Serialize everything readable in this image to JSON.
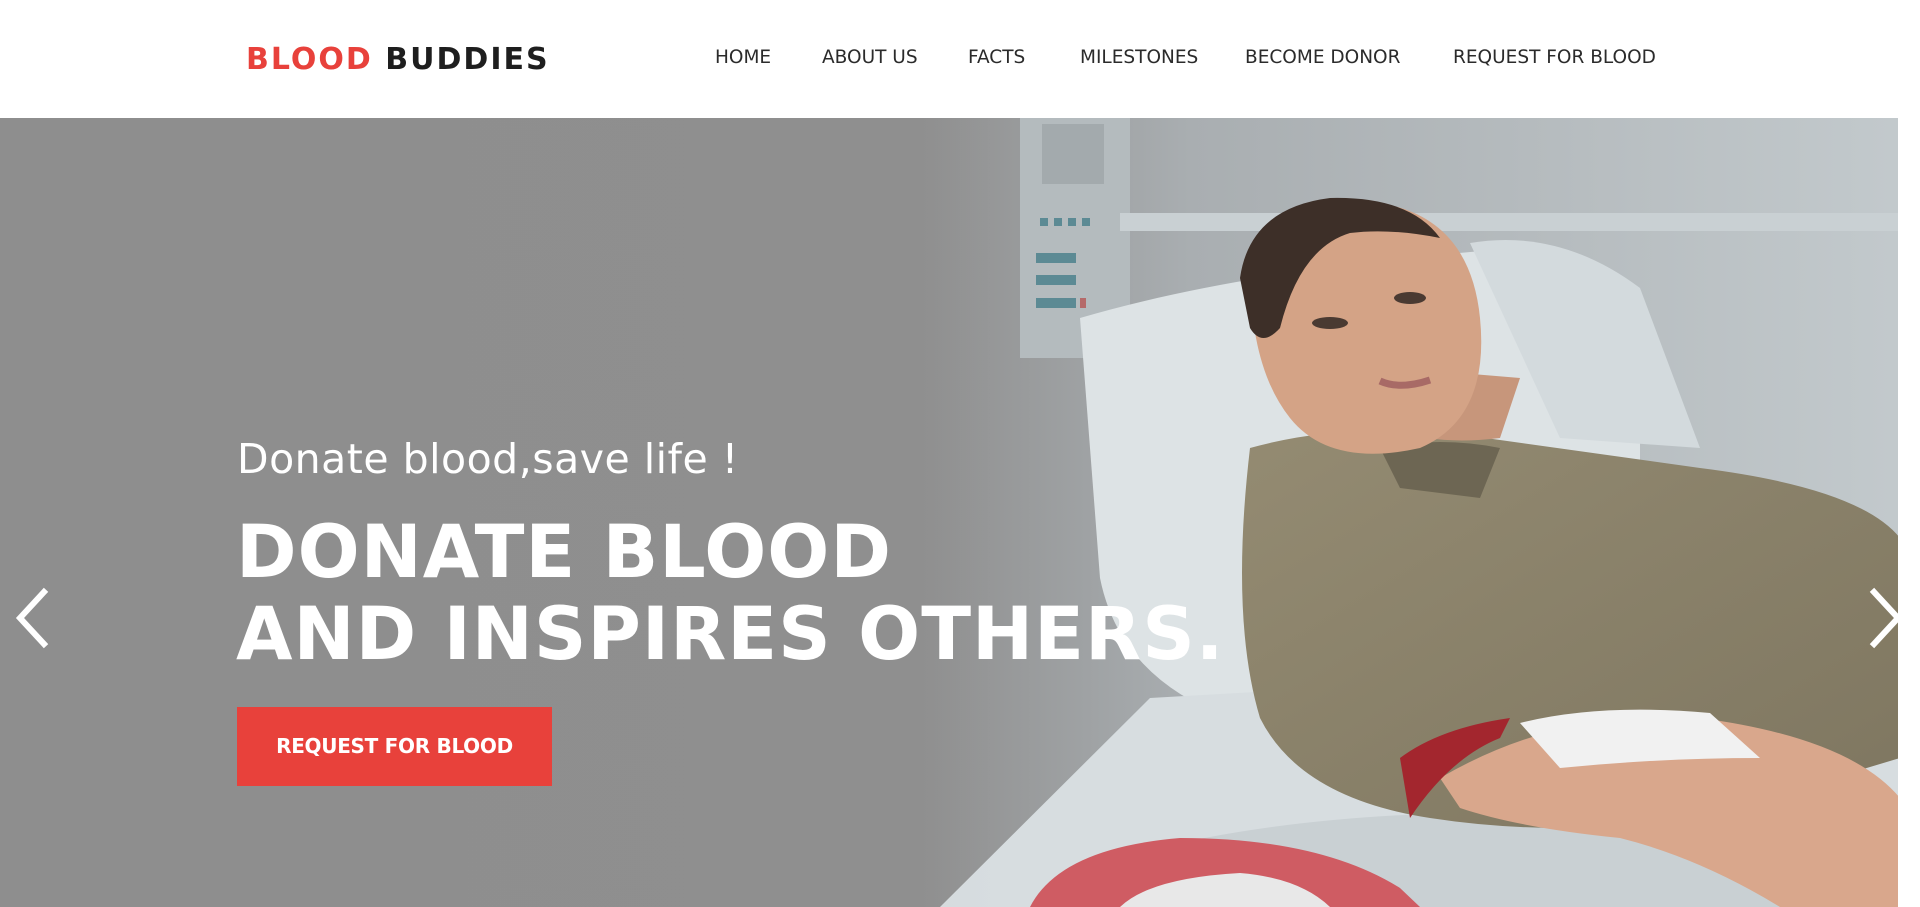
{
  "brand": {
    "part1": "BLOOD",
    "part2": "BUDDIES",
    "accent_color": "#e8413b"
  },
  "nav": {
    "items": [
      {
        "label": "HOME"
      },
      {
        "label": "ABOUT US"
      },
      {
        "label": "FACTS"
      },
      {
        "label": "MILESTONES"
      },
      {
        "label": "BECOME DONOR"
      },
      {
        "label": "REQUEST FOR BLOOD"
      }
    ]
  },
  "hero": {
    "subtitle": "Donate blood,save life !",
    "headline_line1": "DONATE BLOOD",
    "headline_line2": "AND INSPIRES OTHERS.",
    "cta_label": "REQUEST FOR BLOOD",
    "image": "blood-donor-photo",
    "prev_icon": "chevron-left-icon",
    "next_icon": "chevron-right-icon"
  }
}
